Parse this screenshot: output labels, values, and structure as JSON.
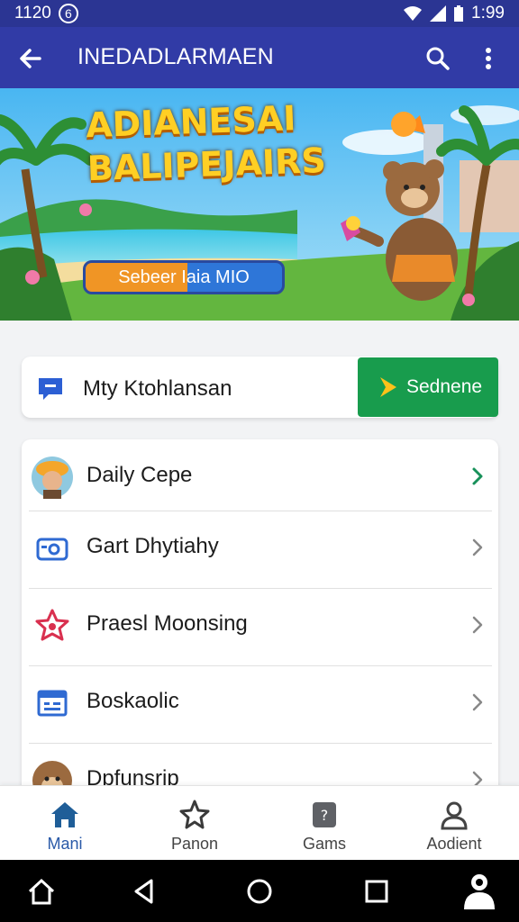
{
  "status_bar": {
    "time_left": "1120",
    "time_right": "1:99"
  },
  "app_bar": {
    "title": "INEDADLARMAEN",
    "back_icon": "arrow-left-icon",
    "search_icon": "search-icon",
    "more_icon": "more-vertical-icon"
  },
  "hero": {
    "title_line1": "ADIANESAI",
    "title_line2": "BALIPEJAIRS",
    "button_label": "Sebeer Iaia MIO"
  },
  "code_card": {
    "label": "Mty Ktohlansan",
    "button_label": "Sednene",
    "icon": "chat-icon",
    "accent": "#189c4d"
  },
  "list": {
    "items": [
      {
        "label": "Daily Cepe",
        "icon": "avatar-hat-icon"
      },
      {
        "label": "Gart Dhytiahy",
        "icon": "camera-icon"
      },
      {
        "label": "Praesl Moonsing",
        "icon": "star-badge-icon"
      },
      {
        "label": "Boskaolic",
        "icon": "calendar-icon"
      },
      {
        "label": "Dpfunsrip",
        "icon": "avatar-monkey-icon"
      }
    ]
  },
  "bottom_nav": {
    "items": [
      {
        "label": "Mani",
        "icon": "home-icon"
      },
      {
        "label": "Panon",
        "icon": "star-icon"
      },
      {
        "label": "Gams",
        "icon": "game-icon"
      },
      {
        "label": "Aodient",
        "icon": "person-icon"
      }
    ]
  },
  "system_nav": {
    "items": [
      "home-outline-icon",
      "back-triangle-icon",
      "home-circle-icon",
      "recents-square-icon",
      "user-badge-icon"
    ]
  }
}
